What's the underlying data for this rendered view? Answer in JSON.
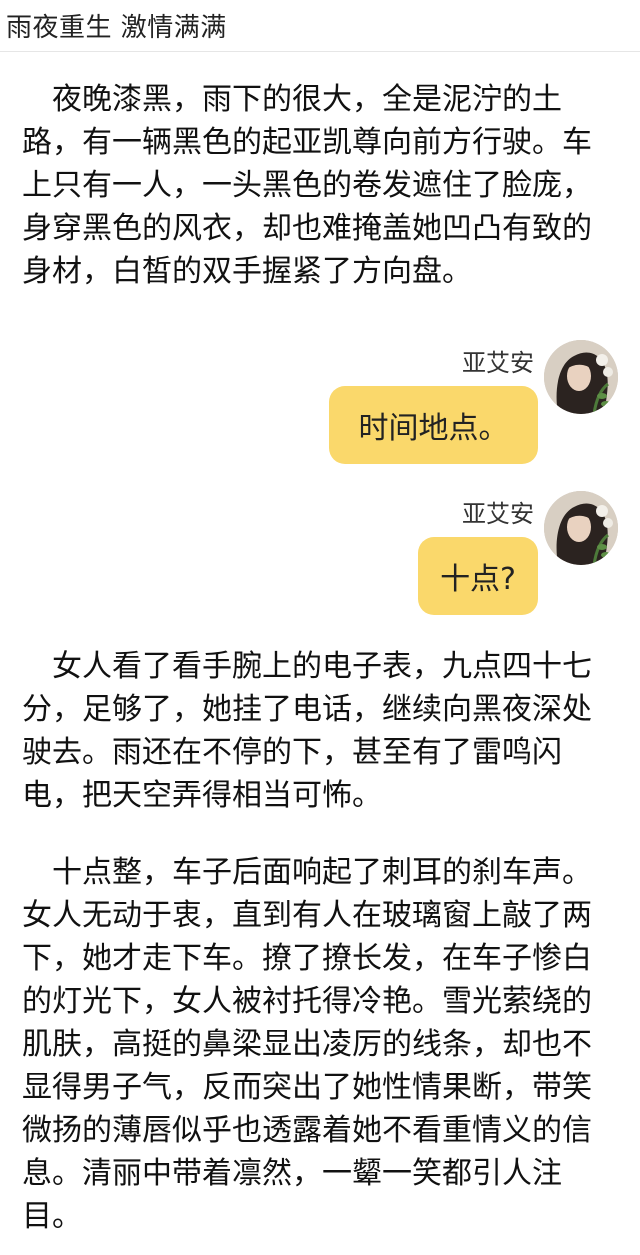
{
  "header": {
    "title": "雨夜重生 激情满满"
  },
  "paragraphs": [
    "夜晚漆黑，雨下的很大，全是泥泞的土路，有一辆黑色的起亚凯尊向前方行驶。车上只有一人，一头黑色的卷发遮住了脸庞，身穿黑色的风衣，却也难掩盖她凹凸有致的身材，白皙的双手握紧了方向盘。",
    "女人看了看手腕上的电子表，九点四十七分，足够了，她挂了电话，继续向黑夜深处驶去。雨还在不停的下，甚至有了雷鸣闪电，把天空弄得相当可怖。",
    "十点整，车子后面响起了刺耳的刹车声。女人无动于衷，直到有人在玻璃窗上敲了两下，她才走下车。撩了撩长发，在车子惨白的灯光下，女人被衬托得冷艳。雪光萦绕的肌肤，高挺的鼻梁显出凌厉的线条，却也不显得男子气，反而突出了她性情果断，带笑微扬的薄唇似乎也透露着她不看重情义的信息。清丽中带着凛然，一颦一笑都引人注目。"
  ],
  "messages": [
    {
      "sender": "亚艾安",
      "text": "时间地点。"
    },
    {
      "sender": "亚艾安",
      "text": "十点?"
    }
  ],
  "colors": {
    "bubble": "#fad86b",
    "text": "#111111"
  }
}
